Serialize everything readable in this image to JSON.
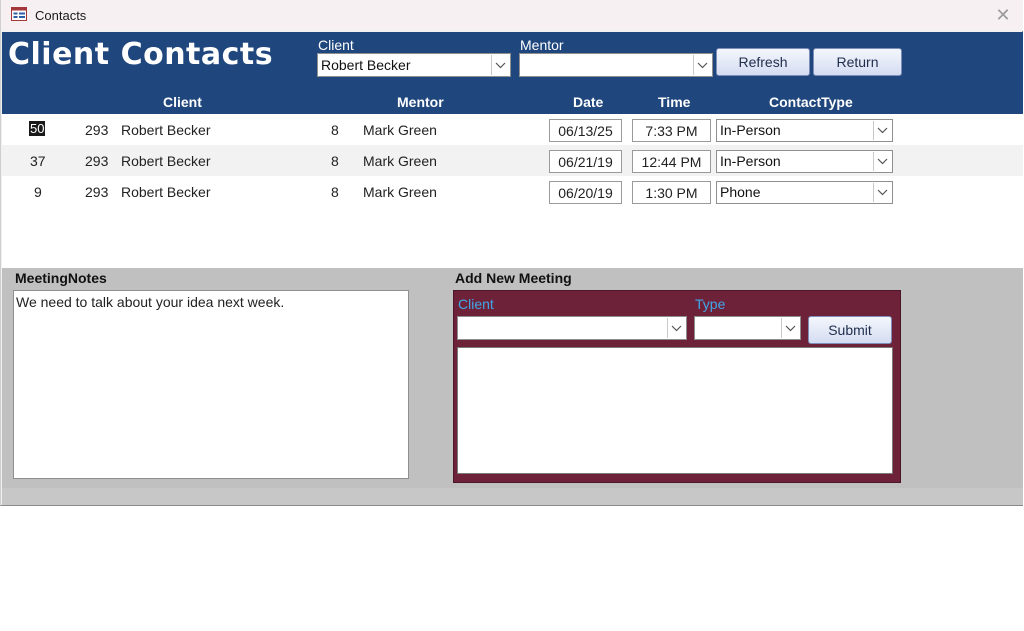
{
  "window": {
    "title": "Contacts",
    "close_glyph": "✕"
  },
  "header": {
    "title": "Client Contacts",
    "client_label": "Client",
    "client_value": "Robert Becker",
    "mentor_label": "Mentor",
    "mentor_value": "",
    "refresh_label": "Refresh",
    "return_label": "Return",
    "columns": {
      "client": "Client",
      "mentor": "Mentor",
      "date": "Date",
      "time": "Time",
      "contact_type": "ContactType"
    }
  },
  "rows": [
    {
      "id": "50",
      "client_id": "293",
      "client": "Robert Becker",
      "mentor_id": "8",
      "mentor": "Mark Green",
      "date": "06/13/25",
      "time": "7:33 PM",
      "contact_type": "In-Person"
    },
    {
      "id": "37",
      "client_id": "293",
      "client": "Robert Becker",
      "mentor_id": "8",
      "mentor": "Mark Green",
      "date": "06/21/19",
      "time": "12:44 PM",
      "contact_type": "In-Person"
    },
    {
      "id": "9",
      "client_id": "293",
      "client": "Robert Becker",
      "mentor_id": "8",
      "mentor": "Mark Green",
      "date": "06/20/19",
      "time": "1:30 PM",
      "contact_type": "Phone"
    }
  ],
  "notes": {
    "label": "MeetingNotes",
    "text": "We need to talk about your idea next week."
  },
  "new_meeting": {
    "label": "Add New Meeting",
    "client_label": "Client",
    "client_value": "",
    "type_label": "Type",
    "type_value": "",
    "submit_label": "Submit",
    "notes_value": ""
  },
  "colors": {
    "header_bg": "#1f477d",
    "panel_bg": "#6d223a",
    "panel_label": "#41a6e6",
    "lower_bg": "#c0c0c0"
  },
  "icons": {
    "app": "form-icon",
    "dropdown": "chevron-down-icon",
    "close": "close-icon"
  }
}
